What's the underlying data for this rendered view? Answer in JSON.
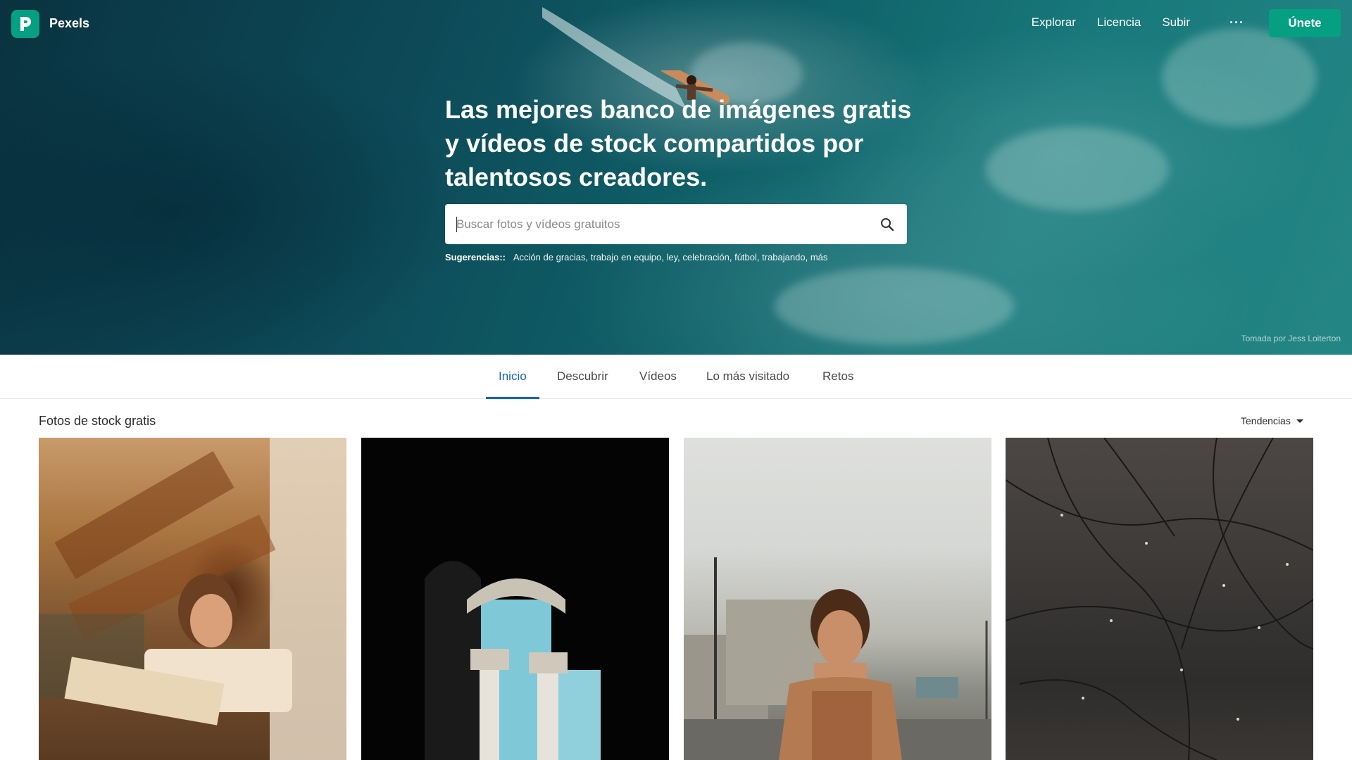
{
  "header": {
    "brand": "Pexels",
    "nav": [
      "Explorar",
      "Licencia",
      "Subir"
    ],
    "more": "···",
    "join_label": "Únete"
  },
  "hero": {
    "title": "Las mejores banco de imágenes gratis y vídeos de stock compartidos por talentosos creadores.",
    "search_placeholder": "Buscar fotos y vídeos gratuitos",
    "suggestions_label": "Sugerencias::",
    "suggestions": [
      "Acción de gracias",
      "trabajo en equipo",
      "ley",
      "celebración",
      "fútbol",
      "trabajando",
      "más"
    ],
    "credit": "Tomada por Jess Loiterton"
  },
  "tabs": [
    {
      "label": "Inicio",
      "active": true
    },
    {
      "label": "Descubrir",
      "active": false
    },
    {
      "label": "Vídeos",
      "active": false
    },
    {
      "label": "Lo más visitado",
      "active": false
    },
    {
      "label": "Retos",
      "active": false
    }
  ],
  "content": {
    "section_title": "Fotos de stock gratis",
    "sort_label": "Tendencias"
  },
  "colors": {
    "brand_green": "#05a081",
    "active_tab": "#1565c0"
  },
  "icons": [
    "pexels-logo-icon",
    "search-icon",
    "chevron-down-icon"
  ]
}
